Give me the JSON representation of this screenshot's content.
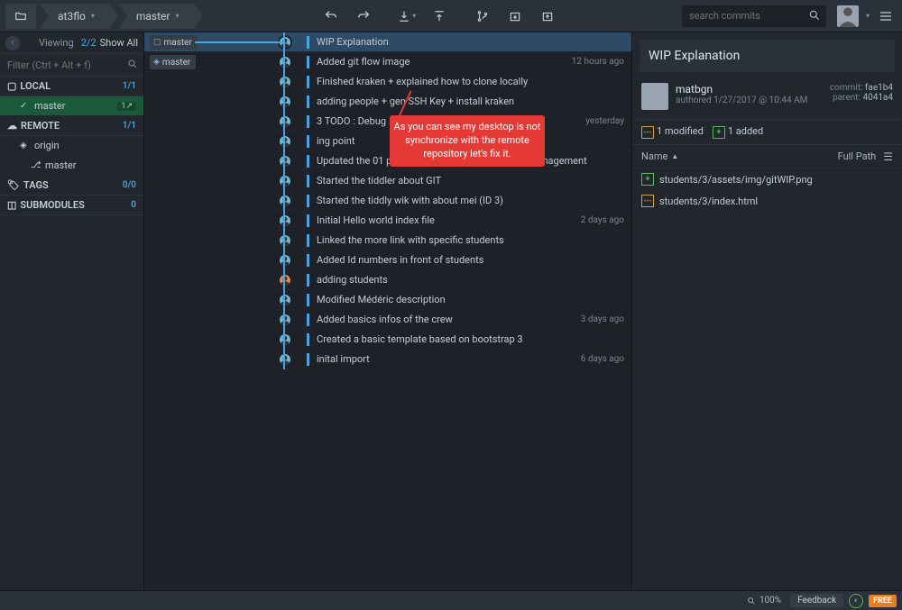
{
  "breadcrumb": {
    "repo": "at3flo",
    "branch": "master"
  },
  "search": {
    "placeholder": "search commits"
  },
  "sidebar": {
    "viewing_label": "Viewing",
    "viewing_count": "2/2",
    "show_all": "Show All",
    "filter_placeholder": "Filter (Ctrl + Alt + f)",
    "sections": {
      "local": {
        "title": "LOCAL",
        "count": "1/1",
        "items": [
          {
            "name": "master",
            "badge": "1↗"
          }
        ]
      },
      "remote": {
        "title": "REMOTE",
        "count": "1/1",
        "items": [
          {
            "name": "origin",
            "type": "origin"
          },
          {
            "name": "master",
            "type": "branch"
          }
        ]
      },
      "tags": {
        "title": "TAGS",
        "count": "0/0"
      },
      "submodules": {
        "title": "SUBMODULES",
        "count": "0"
      }
    }
  },
  "refs": {
    "local": "master",
    "remote": "master"
  },
  "commits": [
    {
      "msg": "WIP Explanation",
      "time": "",
      "selected": true
    },
    {
      "msg": "Added git flow image",
      "time": "12 hours ago"
    },
    {
      "msg": "Finished kraken + explained how to clone locally",
      "time": ""
    },
    {
      "msg": "adding people + gen SSH Key + install kraken",
      "time": ""
    },
    {
      "msg": "3 TODO : Debug",
      "time": "yesterday"
    },
    {
      "msg": "ing point",
      "time": ""
    },
    {
      "msg": "Updated the 01 principles and practices, project management",
      "time": ""
    },
    {
      "msg": "Started the tiddler about GIT",
      "time": ""
    },
    {
      "msg": "Started the tiddly wik with about mei (ID 3)",
      "time": ""
    },
    {
      "msg": "Initial Hello world index file",
      "time": "2 days ago"
    },
    {
      "msg": "Linked the more link with specific students",
      "time": ""
    },
    {
      "msg": "Added Id numbers in front of students",
      "time": ""
    },
    {
      "msg": "adding students",
      "time": "",
      "orange": true
    },
    {
      "msg": "Modified Médéric description",
      "time": ""
    },
    {
      "msg": "Added basics infos of the crew",
      "time": "3 days ago"
    },
    {
      "msg": "Created a basic template based on bootstrap 3",
      "time": ""
    },
    {
      "msg": "inital import",
      "time": "6 days ago"
    }
  ],
  "callout": "As you can see my desktop is not synchronize with the remote repository let's fix it.",
  "detail": {
    "title": "WIP Explanation",
    "author": "matbgn",
    "date": "authored 1/27/2017 @ 10:44 AM",
    "commit_label": "commit:",
    "commit_hash": "fae1b4",
    "parent_label": "parent:",
    "parent_hash": "4041a4",
    "stats": {
      "modified": "1 modified",
      "added": "1 added"
    },
    "files_head": {
      "name": "Name",
      "fullpath": "Full Path"
    },
    "files": [
      {
        "type": "add",
        "path": "students/3/assets/img/gitWIP.png"
      },
      {
        "type": "mod",
        "path": "students/3/index.html"
      }
    ]
  },
  "status": {
    "zoom": "100%",
    "feedback": "Feedback",
    "free": "FREE"
  }
}
